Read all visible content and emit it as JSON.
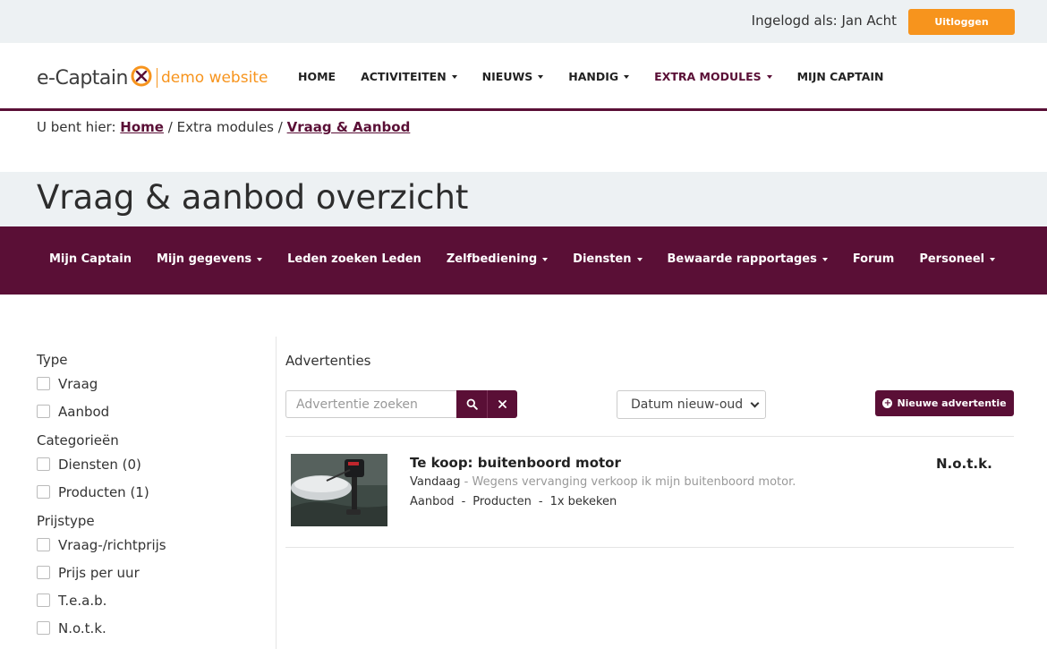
{
  "topbar": {
    "logged_in_as": "Ingelogd als: Jan Acht",
    "logout_label": "Uitloggen"
  },
  "header": {
    "brand": "e-Captain",
    "tagline": "demo website",
    "nav": [
      {
        "label": "HOME",
        "has_dropdown": false
      },
      {
        "label": "ACTIVITEITEN",
        "has_dropdown": true
      },
      {
        "label": "NIEUWS",
        "has_dropdown": true
      },
      {
        "label": "HANDIG",
        "has_dropdown": true
      },
      {
        "label": "EXTRA MODULES",
        "has_dropdown": true,
        "active": true
      },
      {
        "label": "MIJN CAPTAIN",
        "has_dropdown": false
      }
    ]
  },
  "breadcrumb": {
    "prefix": "U bent hier:",
    "home": "Home",
    "sep": "/",
    "middle": "Extra modules",
    "current": "Vraag & Aanbod"
  },
  "page_title": "Vraag & aanbod overzicht",
  "subnav": [
    {
      "label": "Mijn Captain",
      "has_dropdown": false
    },
    {
      "label": "Mijn gegevens",
      "has_dropdown": true
    },
    {
      "label": "Leden zoeken Leden",
      "has_dropdown": false
    },
    {
      "label": "Zelfbediening",
      "has_dropdown": true
    },
    {
      "label": "Diensten",
      "has_dropdown": true
    },
    {
      "label": "Bewaarde rapportages",
      "has_dropdown": true
    },
    {
      "label": "Forum",
      "has_dropdown": false
    },
    {
      "label": "Personeel",
      "has_dropdown": true
    }
  ],
  "filters": {
    "type": {
      "title": "Type",
      "options": [
        "Vraag",
        "Aanbod"
      ]
    },
    "categories": {
      "title": "Categorieën",
      "options": [
        "Diensten (0)",
        "Producten (1)"
      ]
    },
    "price_type": {
      "title": "Prijstype",
      "options": [
        "Vraag-/richtprijs",
        "Prijs per uur",
        "T.e.a.b.",
        "N.o.t.k."
      ]
    }
  },
  "main": {
    "section_title": "Advertenties",
    "search_placeholder": "Advertentie zoeken",
    "sort_selected": "Datum nieuw-oud",
    "new_ad_label": "Nieuwe advertentie",
    "listings": [
      {
        "title": "Te koop: buitenboord motor",
        "when": "Vandaag",
        "desc_sep": " - ",
        "description": "Wegens vervanging verkoop ik mijn buitenboord motor.",
        "type": "Aanbod",
        "category": "Producten",
        "views": "1x bekeken",
        "price": "N.o.t.k."
      }
    ]
  },
  "colors": {
    "brand": "#5a0f36",
    "accent": "#f7941d",
    "band": "#edf1f3"
  },
  "icons": {
    "search": "search-icon",
    "clear": "close-icon",
    "new": "plus-circle-icon",
    "sort": "chevron-down-icon"
  }
}
